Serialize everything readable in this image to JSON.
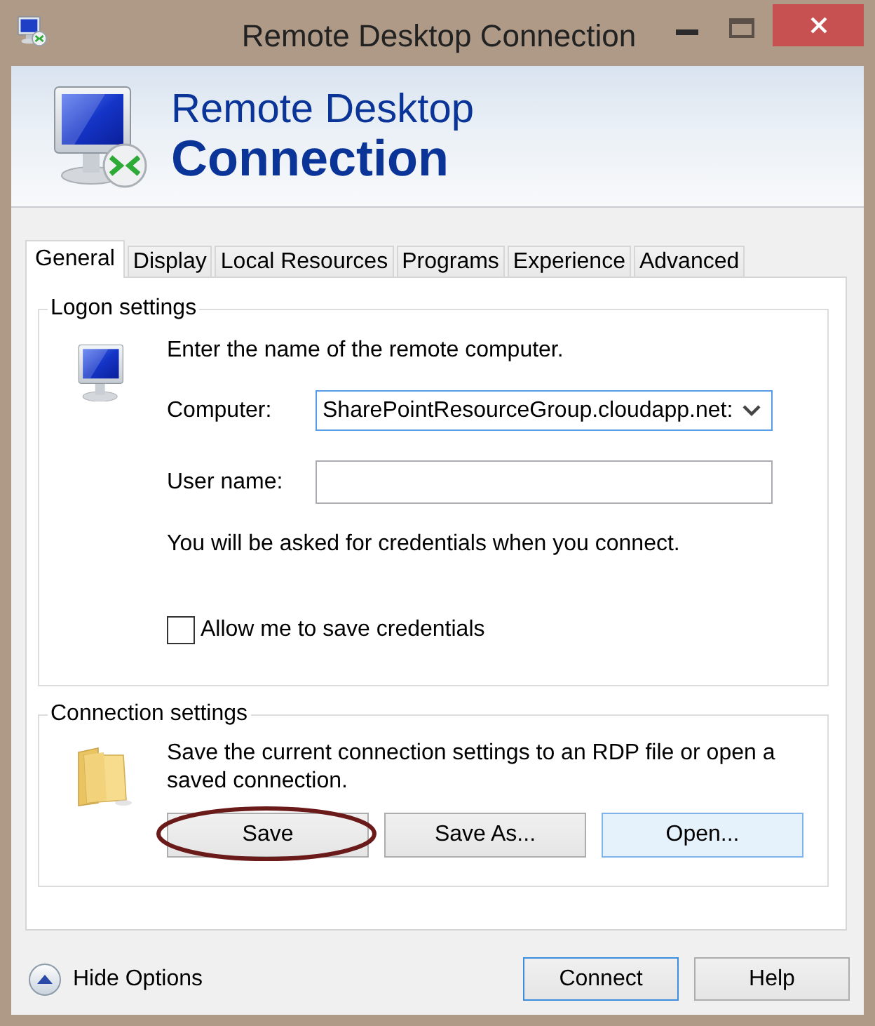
{
  "window": {
    "title": "Remote Desktop Connection"
  },
  "banner": {
    "line_1": "Remote Desktop",
    "line_2": "Connection"
  },
  "tabs": [
    {
      "label": "General",
      "selected": true
    },
    {
      "label": "Display",
      "selected": false
    },
    {
      "label": "Local Resources",
      "selected": false
    },
    {
      "label": "Programs",
      "selected": false
    },
    {
      "label": "Experience",
      "selected": false
    },
    {
      "label": "Advanced",
      "selected": false
    }
  ],
  "logon_settings": {
    "title": "Logon settings",
    "prompt": "Enter the name of the remote computer.",
    "fields": [
      {
        "kind": "combo",
        "label": "Computer:",
        "value": "SharePointResourceGroup.cloudapp.net:",
        "focused": true
      },
      {
        "kind": "text",
        "label": "User name:",
        "focused": false
      }
    ],
    "note": "You will be asked for credentials when you connect.",
    "checkbox": {
      "label": "Allow me to save credentials",
      "checked": false
    }
  },
  "connection_settings": {
    "title": "Connection settings",
    "description": "Save the current connection settings to an RDP file or open a saved connection.",
    "buttons": [
      {
        "label": "Save",
        "hover": false,
        "circled": true
      },
      {
        "label": "Save As...",
        "hover": false,
        "circled": false
      },
      {
        "label": "Open...",
        "hover": true,
        "circled": false
      }
    ]
  },
  "footer": {
    "toggle": {
      "label": "Hide Options"
    },
    "buttons": [
      {
        "label": "Connect",
        "default": true
      },
      {
        "label": "Help",
        "default": false
      }
    ]
  }
}
